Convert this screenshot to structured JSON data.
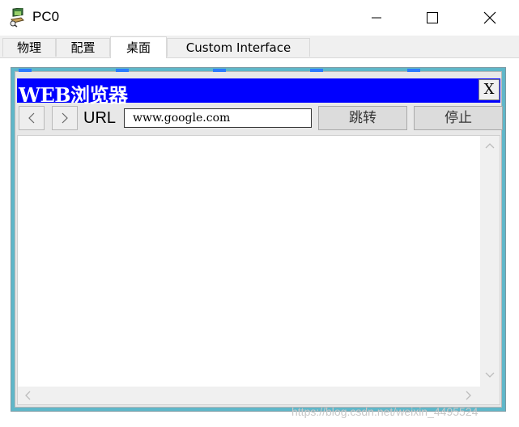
{
  "window": {
    "title": "PC0",
    "icon": "pc-device-icon"
  },
  "tabs": [
    {
      "label": "物理"
    },
    {
      "label": "配置"
    },
    {
      "label": "桌面",
      "active": true
    },
    {
      "label": "Custom Interface"
    }
  ],
  "browser": {
    "title": "WEB浏览器",
    "close_label": "X",
    "url_label": "URL",
    "url_value": "www.google.com",
    "go_label": "跳转",
    "stop_label": "停止"
  },
  "watermark": "https://blog.csdn.net/weixin_4495524",
  "colors": {
    "browser_title_bg": "#0000ff",
    "frame_border": "#5fb7c9"
  }
}
